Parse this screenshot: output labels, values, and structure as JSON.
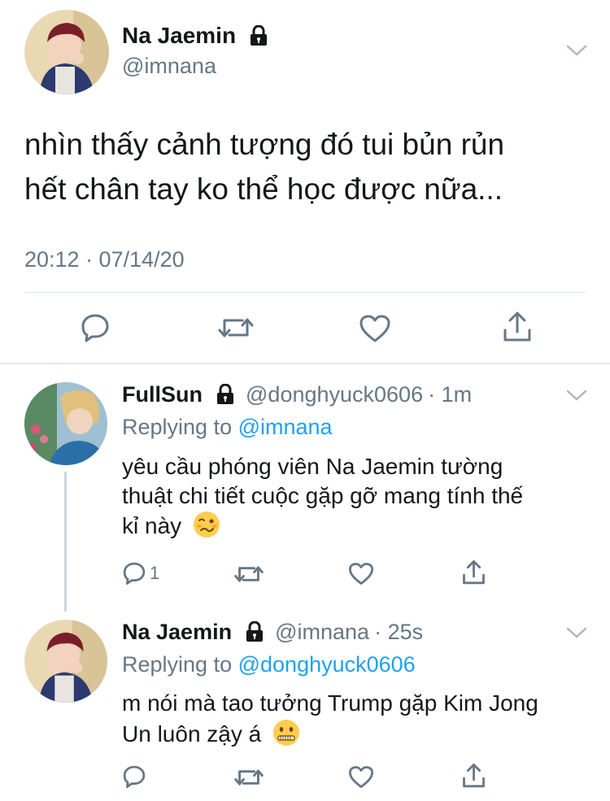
{
  "main_tweet": {
    "display_name": "Na Jaemin",
    "handle": "@imnana",
    "text_line1": "nhìn thấy cảnh tượng đó tui bủn rủn",
    "text_line2": "hết chân tay ko thể học được nữa...",
    "timestamp": "20:12 · 07/14/20"
  },
  "replies": [
    {
      "display_name": "FullSun",
      "handle": "@donghyuck0606",
      "time": "· 1m",
      "replying_prefix": "Replying to",
      "replying_to": "@imnana",
      "text_line1": "yêu cầu phóng viên Na Jaemin tường",
      "text_line2": "thuật chi tiết cuộc gặp gỡ mang tính thế",
      "text_line3": "kỉ này",
      "emoji": "woozy-face",
      "reply_count": "1"
    },
    {
      "display_name": "Na Jaemin",
      "handle": "@imnana",
      "time": "· 25s",
      "replying_prefix": "Replying to",
      "replying_to": "@donghyuck0606",
      "text_line1": "m nói mà tao tưởng Trump gặp Kim Jong",
      "text_line2": "Un luôn zậy á",
      "emoji": "zipper-mouth-face"
    }
  ],
  "colors": {
    "text": "#14171a",
    "secondary": "#657786",
    "link": "#1da1f2",
    "divider": "#e1e8ed"
  }
}
